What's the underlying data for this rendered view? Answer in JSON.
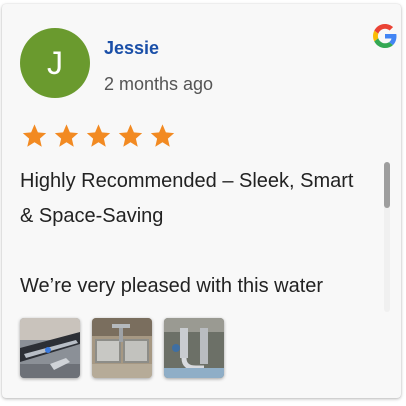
{
  "review": {
    "author_initial": "J",
    "author_name": "Jessie",
    "time_ago": "2 months ago",
    "rating": 5,
    "rating_max": 5,
    "title_line": "Highly Recommended – Sleek, Smart & Space-Saving",
    "body_line": "We’re very pleased with this water",
    "source_icon": "google-g-icon",
    "photos": [
      {
        "icon": "faucet-photo"
      },
      {
        "icon": "sink-photo"
      },
      {
        "icon": "under-sink-pipes-photo"
      }
    ]
  },
  "colors": {
    "avatar_bg": "#6a9a2e",
    "name_link": "#1a4fa8",
    "star": "#f28a22",
    "card_bg": "#f8f8f8"
  }
}
